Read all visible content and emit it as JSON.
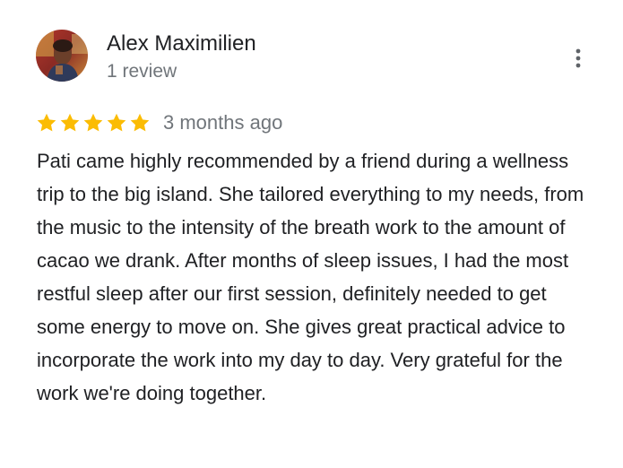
{
  "review": {
    "author_name": "Alex Maximilien",
    "review_count": "1 review",
    "rating": 5,
    "rating_max": 5,
    "time": "3 months ago",
    "text": "Pati came highly recommended by a friend during a wellness trip to the big island. She tailored everything to my needs, from the music to the intensity of the breath work to the amount of cacao we drank. After months of sleep issues, I had the most restful sleep after our first session, definitely needed to get some energy to move on. She gives great practical advice to incorporate the work into my day to day. Very grateful for the work we're doing together."
  },
  "icons": {
    "star": "star-icon",
    "more": "more-vert-icon",
    "avatar": "avatar"
  },
  "colors": {
    "star": "#fbbc04",
    "name": "#202124",
    "secondary_text": "#70757a",
    "menu_dots": "#5f6368"
  }
}
